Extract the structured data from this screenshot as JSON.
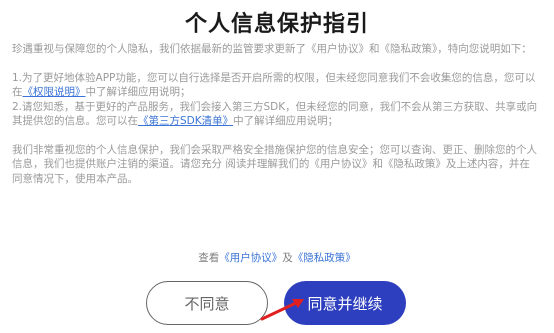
{
  "dialog": {
    "title": "个人信息保护指引",
    "intro": "珍遇重视与保障您的个人隐私，我们依据最新的监管要求更新了《用户协议》和《隐私政策》，特向您说明如下：",
    "p1_a": "1.为了更好地体验APP功能，您可以自行选择是否开启所需的权限，但未经您同意我们不会收集您的信息，您可以在",
    "p1_link": "《权限说明》",
    "p1_b": "中了解详细应用说明；",
    "p2_a": "2.请您知悉，基于更好的产品服务，我们会接入第三方SDK，但未经您的同意，我们不会从第三方获取、共享或向其提供您的信息。您可以在",
    "p2_link": "《第三方SDK清单》",
    "p2_b": "中了解详细应用说明；",
    "p3": "我们非常重视您的个人信息保护，我们会采取严格安全措施保护您的信息安全；您可以查询、更正、删除您的个人信息，我们也提供账户注销的渠道。请您充分 阅读并理解我们的《用户协议》和《隐私政策》及上述内容，并在同意情况下，使用本产品。",
    "footer_prefix": "查看",
    "footer_link1": "《用户协议》",
    "footer_joiner": "及",
    "footer_link2": "《隐私政策》",
    "disagree_label": "不同意",
    "agree_label": "同意并继续"
  },
  "colors": {
    "agree_button": "#2d3fbf",
    "link": "#3a74d6",
    "arrow": "#e02020"
  },
  "icons": {
    "annotation": "red-arrow-icon"
  }
}
